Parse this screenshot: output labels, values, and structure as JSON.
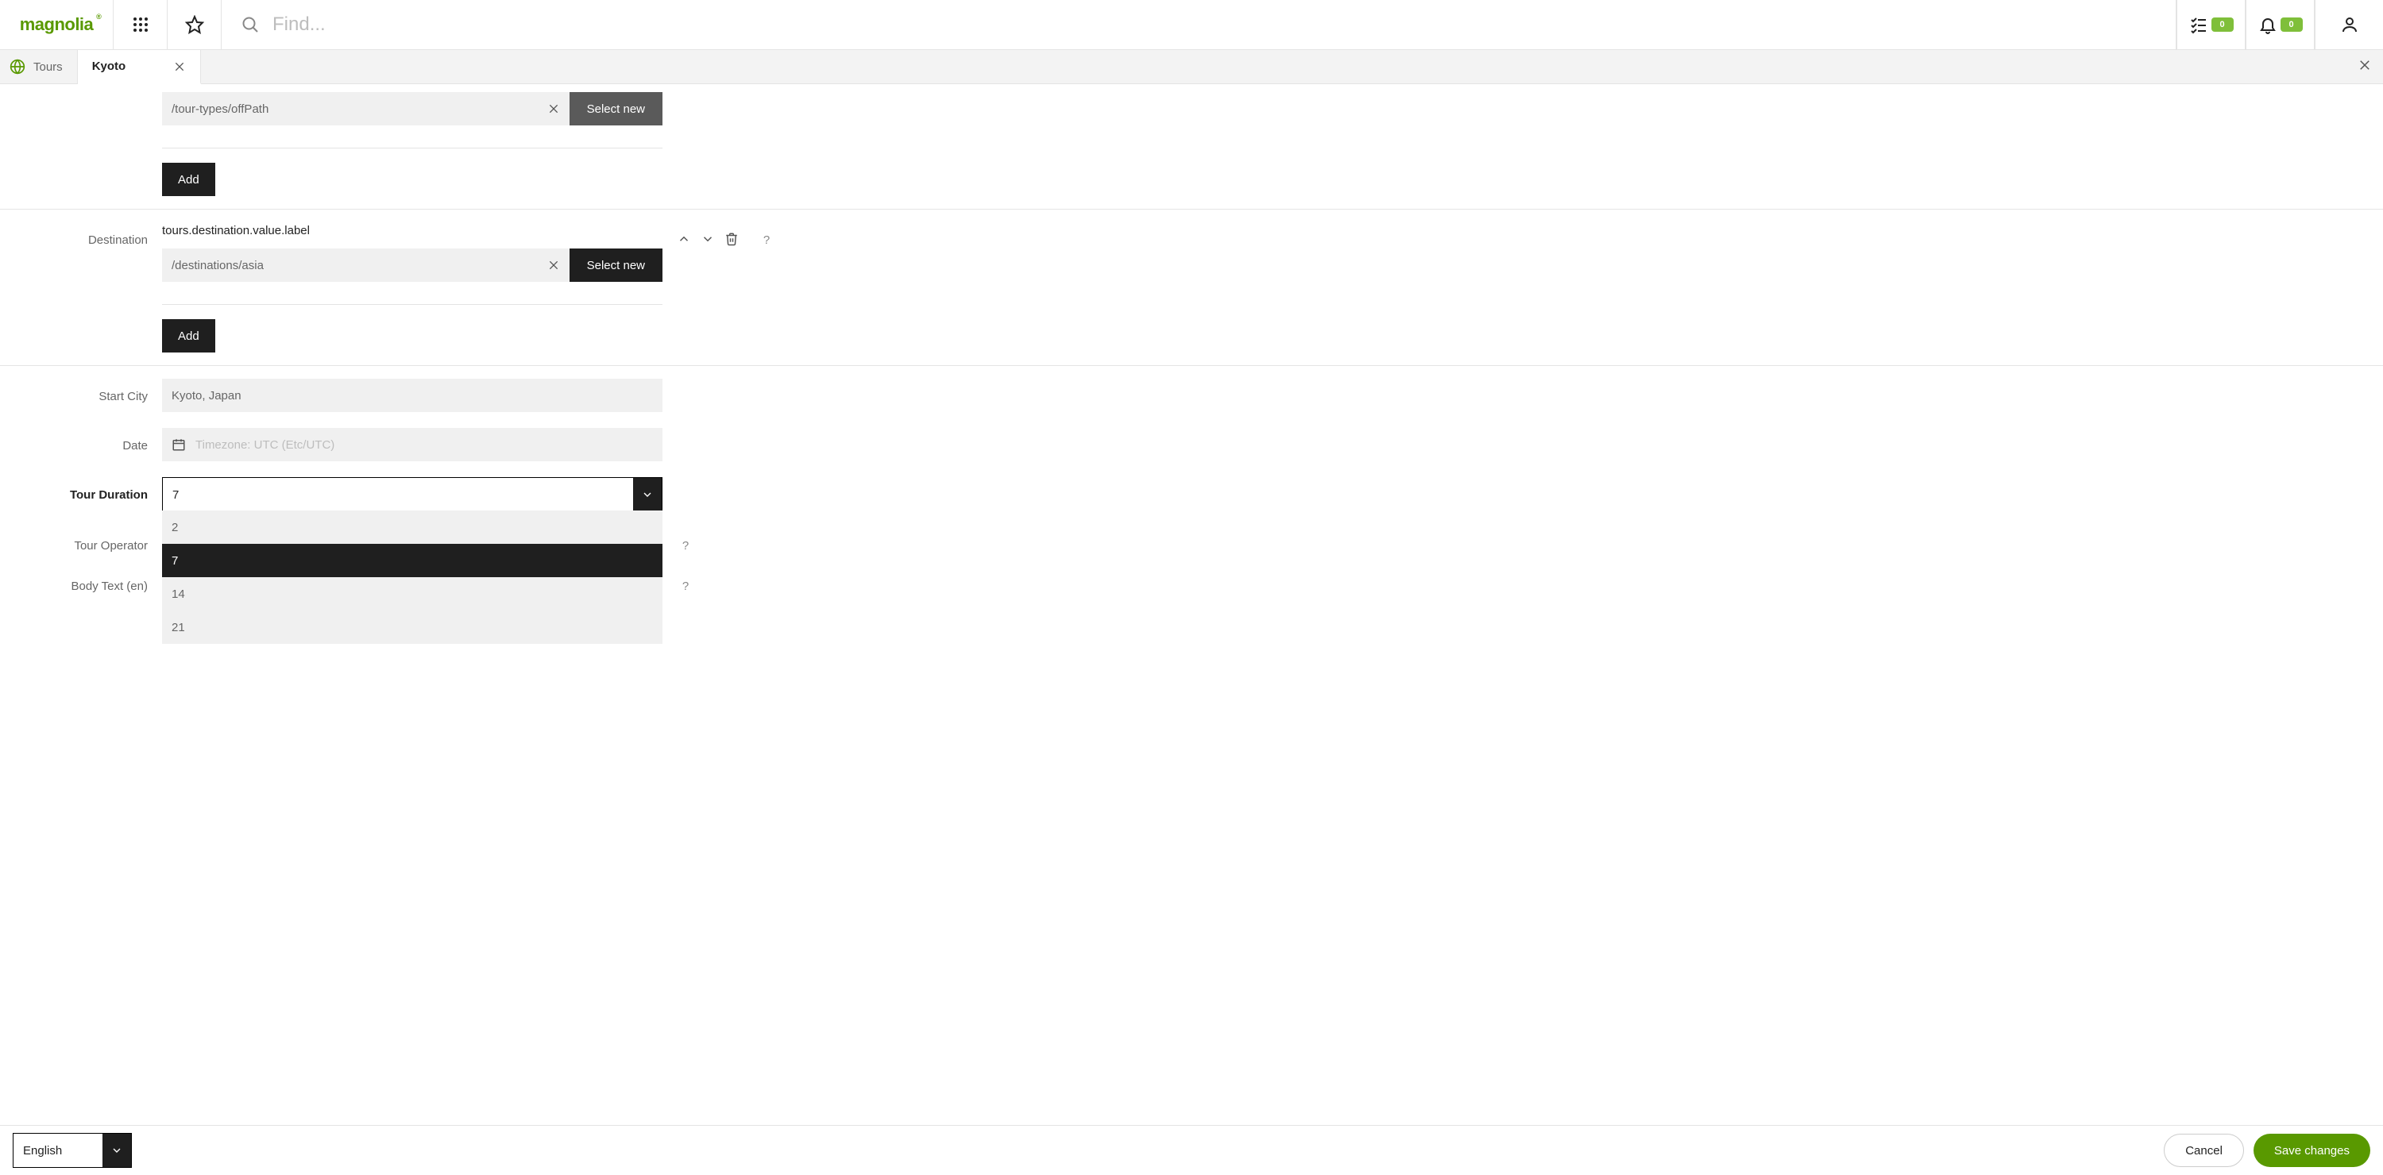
{
  "header": {
    "logo_text": "magnolia",
    "search_placeholder": "Find...",
    "tasks_count": "0",
    "notifications_count": "0"
  },
  "tabs": {
    "app_label": "Tours",
    "doc_label": "Kyoto"
  },
  "form": {
    "tourTypes": {
      "picker_value": "/tour-types/offPath",
      "select_new": "Select new",
      "add": "Add"
    },
    "destination": {
      "label": "Destination",
      "value_label": "tours.destination.value.label",
      "picker_value": "/destinations/asia",
      "select_new": "Select new",
      "add": "Add",
      "help": "?"
    },
    "startCity": {
      "label": "Start City",
      "value": "Kyoto, Japan"
    },
    "date": {
      "label": "Date",
      "placeholder": "Timezone: UTC (Etc/UTC)"
    },
    "duration": {
      "label": "Tour Duration",
      "value": "7",
      "options": [
        "2",
        "7",
        "14",
        "21"
      ]
    },
    "operator": {
      "label": "Tour Operator",
      "help": "?"
    },
    "body": {
      "label": "Body Text (en)",
      "help": "?"
    }
  },
  "footer": {
    "language": "English",
    "cancel": "Cancel",
    "save": "Save changes"
  }
}
